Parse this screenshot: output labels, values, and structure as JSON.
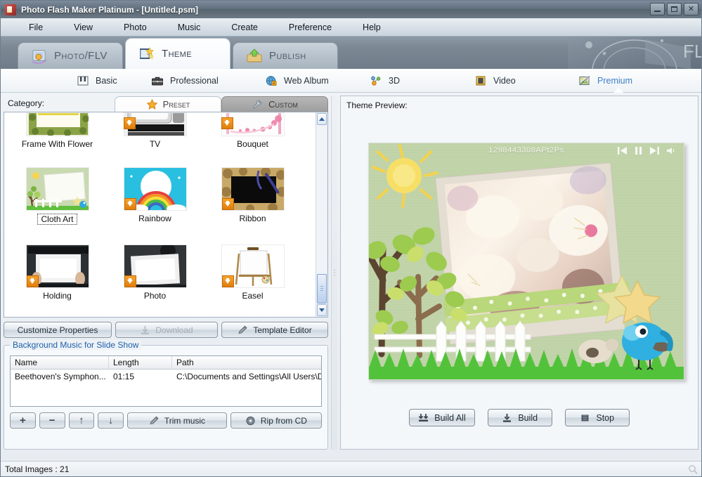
{
  "window": {
    "title_main": "Photo Flash Maker Platinum",
    "title_doc": " - [Untitled.psm]",
    "app_icon": "app-logo-icon",
    "minimize": "minimize-icon",
    "maximize": "maximize-icon",
    "close": "close-icon"
  },
  "menu": {
    "items": [
      {
        "label": "File"
      },
      {
        "label": "View"
      },
      {
        "label": "Photo"
      },
      {
        "label": "Music"
      },
      {
        "label": "Create"
      },
      {
        "label": "Preference"
      },
      {
        "label": "Help"
      }
    ]
  },
  "main_tabs": [
    {
      "label": "Photo/FLV",
      "icon": "photo-flv-icon",
      "active": false
    },
    {
      "label": "Theme",
      "icon": "theme-icon",
      "active": true
    },
    {
      "label": "Publish",
      "icon": "publish-icon",
      "active": false
    }
  ],
  "sub_tabs": [
    {
      "label": "Basic",
      "icon": "piano-keys-icon",
      "active": false
    },
    {
      "label": "Professional",
      "icon": "briefcase-icon",
      "active": false
    },
    {
      "label": "Web Album",
      "icon": "globe-lock-icon",
      "active": false
    },
    {
      "label": "3D",
      "icon": "3d-balls-icon",
      "active": false
    },
    {
      "label": "Video",
      "icon": "film-strip-icon",
      "active": false
    },
    {
      "label": "Premium",
      "icon": "premium-image-icon",
      "active": true
    }
  ],
  "category": {
    "label": "Category:",
    "tabs": [
      {
        "label": "Preset",
        "icon": "star-icon",
        "active": true
      },
      {
        "label": "Custom",
        "icon": "wrench-icon",
        "active": false
      }
    ]
  },
  "themes": {
    "rows": [
      [
        {
          "name": "Frame With Flower",
          "download": false,
          "selected": false,
          "style": "flower"
        },
        {
          "name": "TV",
          "download": true,
          "selected": false,
          "style": "tv"
        },
        {
          "name": "Bouquet",
          "download": true,
          "selected": false,
          "style": "bouquet"
        }
      ],
      [
        {
          "name": "Cloth Art",
          "download": false,
          "selected": true,
          "style": "cloth"
        },
        {
          "name": "Rainbow",
          "download": true,
          "selected": false,
          "style": "rainbow"
        },
        {
          "name": "Ribbon",
          "download": true,
          "selected": false,
          "style": "ribbon"
        }
      ],
      [
        {
          "name": "Holding",
          "download": true,
          "selected": false,
          "style": "holding"
        },
        {
          "name": "Photo",
          "download": true,
          "selected": false,
          "style": "photo"
        },
        {
          "name": "Easel",
          "download": true,
          "selected": false,
          "style": "easel"
        }
      ]
    ],
    "scroll_up": "scroll-up-icon",
    "scroll_down": "scroll-down-icon"
  },
  "theme_actions": [
    {
      "label": "Customize Properties",
      "icon": "",
      "disabled": false
    },
    {
      "label": "Download",
      "icon": "download-icon",
      "disabled": true
    },
    {
      "label": "Template Editor",
      "icon": "pencil-icon",
      "disabled": false
    }
  ],
  "music": {
    "group_label": "Background Music for Slide Show",
    "columns": [
      "Name",
      "Length",
      "Path"
    ],
    "rows": [
      {
        "name": "Beethoven's Symphon...",
        "length": "01:15",
        "path": "C:\\Documents and Settings\\All Users\\D..."
      }
    ],
    "buttons": [
      {
        "label": "+",
        "name": "add-music-button"
      },
      {
        "label": "−",
        "name": "remove-music-button"
      },
      {
        "label": "↑",
        "name": "move-up-button"
      },
      {
        "label": "↓",
        "name": "move-down-button"
      },
      {
        "label": "Trim music",
        "name": "trim-music-button",
        "icon": "pencil-icon"
      },
      {
        "label": "Rip from CD",
        "name": "rip-from-cd-button",
        "icon": "cd-icon"
      }
    ]
  },
  "preview": {
    "label": "Theme Preview:",
    "stage_title": "1298443308APt2Ps",
    "player_controls": [
      {
        "name": "previous-button",
        "icon": "skip-back-icon"
      },
      {
        "name": "pause-button",
        "icon": "pause-icon"
      },
      {
        "name": "next-button",
        "icon": "skip-forward-icon"
      },
      {
        "name": "volume-button",
        "icon": "speaker-icon"
      }
    ],
    "buttons": [
      {
        "label": "Build All",
        "icon": "double-down-arrow-icon"
      },
      {
        "label": "Build",
        "icon": "down-arrow-icon"
      },
      {
        "label": "Stop",
        "icon": "stop-square-icon"
      }
    ]
  },
  "status": {
    "text": "Total Images : 21",
    "resize_grip": "resize-grip-icon"
  },
  "colors": {
    "accent_blue": "#3f7fc4",
    "legend_blue": "#1d5fa8",
    "badge_orange": "#e07d0c",
    "title_gray": "#61707f",
    "stage_green": "#b9ccA6"
  }
}
